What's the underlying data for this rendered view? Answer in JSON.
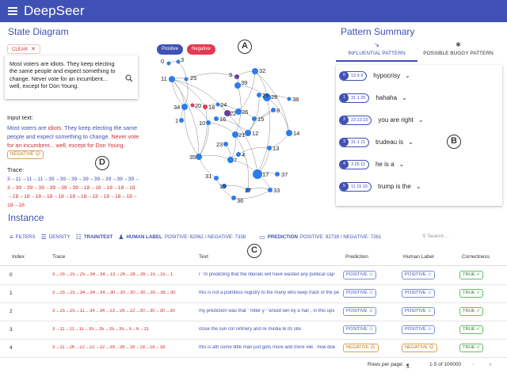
{
  "app": {
    "title": "DeepSeer"
  },
  "state_diagram": {
    "title": "State Diagram",
    "clear_label": "CLEAR",
    "input_box_text": "Most voters are idiots. They keep electing the same people and expect something to change. Never vote for an incumbent... well, except for Don Young.",
    "input_label": "Input text:",
    "input_segments": [
      {
        "text": "Most voters are ",
        "color": "blue"
      },
      {
        "text": "idiots",
        "color": "red"
      },
      {
        "text": ". They keep electing the same people and expect something to change. ",
        "color": "blue"
      },
      {
        "text": "Never vote for an incumbent... well, except for Don Young.",
        "color": "red"
      }
    ],
    "input_prediction": "NEGATIVE",
    "trace_label": "Trace:",
    "trace_segments": [
      {
        "text": "3→11→11→11→39→39→39→39→39→39→39→39→",
        "color": "blue"
      },
      {
        "text": "3→39→39→39→39→39→39→18→18→18→18→18→18→",
        "color": "red"
      },
      {
        "text": "18→18→18→18→18→18→18→18→18→18→18→18",
        "color": "red"
      }
    ],
    "legend": {
      "positive": "Positive",
      "negative": "Negative"
    },
    "colors": {
      "positive": "#3f51b5",
      "negative": "#e53950",
      "node": "#2b7de9"
    },
    "nodes": [
      {
        "id": "0",
        "c": "b"
      },
      {
        "id": "3",
        "c": "b"
      },
      {
        "id": "11",
        "c": "b"
      },
      {
        "id": "25",
        "c": "b"
      },
      {
        "id": "9",
        "c": "p"
      },
      {
        "id": "32",
        "c": "b"
      },
      {
        "id": "18",
        "c": "r"
      },
      {
        "id": "34",
        "c": "b"
      },
      {
        "id": "20",
        "c": "r"
      },
      {
        "id": "24",
        "c": "b"
      },
      {
        "id": "28",
        "c": "b"
      },
      {
        "id": "38",
        "c": "b"
      },
      {
        "id": "22",
        "c": "p"
      },
      {
        "id": "26",
        "c": "b"
      },
      {
        "id": "15",
        "c": "b"
      },
      {
        "id": "10",
        "c": "b"
      },
      {
        "id": "16",
        "c": "b"
      },
      {
        "id": "21",
        "c": "b"
      },
      {
        "id": "12",
        "c": "b"
      },
      {
        "id": "14",
        "c": "b"
      },
      {
        "id": "1",
        "c": "b"
      },
      {
        "id": "29",
        "c": "b"
      },
      {
        "id": "39",
        "c": "b"
      },
      {
        "id": "8",
        "c": "b"
      },
      {
        "id": "35",
        "c": "b"
      },
      {
        "id": "7",
        "c": "b"
      },
      {
        "id": "13",
        "c": "b"
      },
      {
        "id": "4",
        "c": "b"
      },
      {
        "id": "23",
        "c": "b"
      },
      {
        "id": "31",
        "c": "b"
      },
      {
        "id": "17",
        "c": "b"
      },
      {
        "id": "37",
        "c": "b"
      },
      {
        "id": "27",
        "c": "b"
      },
      {
        "id": "33",
        "c": "b"
      },
      {
        "id": "36",
        "c": "b"
      },
      {
        "id": "19",
        "c": "b"
      }
    ]
  },
  "pattern_summary": {
    "title": "Pattern Summary",
    "tabs": [
      "INFLUENTIAL PATTERN",
      "POSSIBLE BUGGY PATTERN"
    ],
    "patterns": [
      {
        "num": "0",
        "trace": "13 9 9",
        "text": "hypocrisy"
      },
      {
        "num": "1",
        "trace": "31 1 25",
        "text": "hahaha"
      },
      {
        "num": "2",
        "trace": "23 23 23",
        "text": "you are right"
      },
      {
        "num": "3",
        "trace": "31 1 11",
        "text": "trudeau is"
      },
      {
        "num": "4",
        "trace": "3 25 11",
        "text": "he is a"
      },
      {
        "num": "5",
        "trace": "11 15 15",
        "text": "trump is the"
      }
    ]
  },
  "instance": {
    "title": "Instance",
    "toolbar": {
      "filters": "FILTERS",
      "density": "DENSITY",
      "traintest": "TRAIN/TEST",
      "human_label": "HUMAN LABEL",
      "human_values": "POSITIVE: 62062 / NEGATIVE: 7338",
      "prediction": "PREDICTION",
      "prediction_values": "POSITIVE: 92739 / NEGATIVE: 7261",
      "search_placeholder": "Search…"
    },
    "columns": [
      "Index",
      "Trace",
      "Text",
      "Prediction",
      "Human Label",
      "Correctness"
    ],
    "rows": [
      {
        "index": "0",
        "trace": "3→25→25→25→34→34→13→26→26→26→15→15→1",
        "text": "I ' m predicting that the liberals will have wasted any political cap",
        "prediction": "POSITIVE",
        "human": "POSITIVE",
        "correct": "TRUE"
      },
      {
        "index": "1",
        "trace": "3→25→25→34→34→34→30→30→30→30→30→38→30",
        "text": "this is not a pointless registry to the many who keep track of the pe",
        "prediction": "POSITIVE",
        "human": "POSITIVE",
        "correct": "TRUE"
      },
      {
        "index": "2",
        "trace": "3→25→25→11→34→34→13→26→22→30→30→30→30",
        "text": "my prediction was that \" hitler y \" would win by a hair , in this ups",
        "prediction": "POSITIVE",
        "human": "POSITIVE",
        "correct": "TRUE"
      },
      {
        "index": "3",
        "trace": "3→11→11→11→35→35→35→35→5→6→31",
        "text": "close the sun cor refinery and re media te its site",
        "prediction": "POSITIVE",
        "human": "POSITIVE",
        "correct": "TRUE"
      },
      {
        "index": "4",
        "trace": "3→11→26→22→22→22→39→39→18→18→18→18",
        "text": "this is ath some little man just gets more and more vile . how doe",
        "prediction": "NEGATIVE",
        "human": "NEGATIVE",
        "correct": "TRUE"
      }
    ],
    "footer": {
      "rows_per_page_label": "Rows per page:",
      "rows_per_page": "5",
      "range": "1-5 of 100000"
    }
  },
  "annotations": [
    "A",
    "B",
    "C",
    "D"
  ]
}
